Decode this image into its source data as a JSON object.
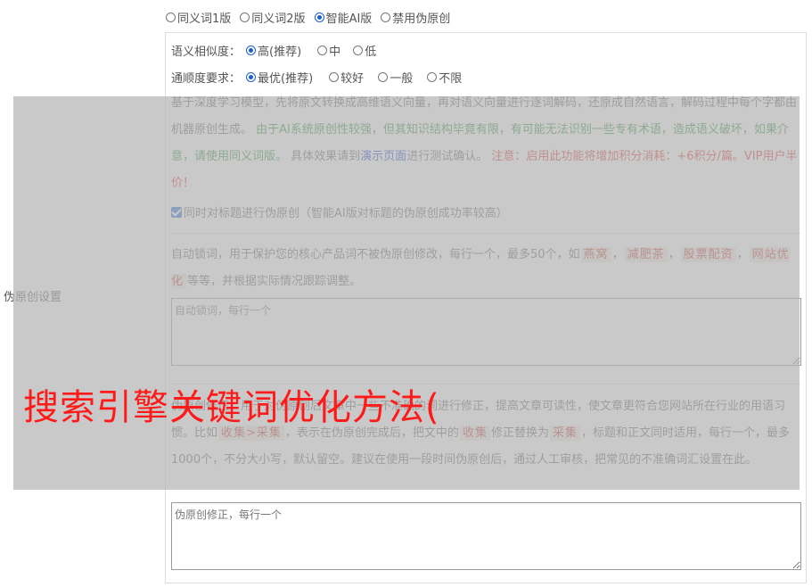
{
  "mode_options": [
    {
      "label": "同义词1版",
      "checked": false
    },
    {
      "label": "同义词2版",
      "checked": false
    },
    {
      "label": "智能AI版",
      "checked": true
    },
    {
      "label": "禁用伪原创",
      "checked": false
    }
  ],
  "section_label": "伪原创设置",
  "similarity": {
    "label": "语义相似度：",
    "options": [
      {
        "label": "高(推荐)",
        "checked": true
      },
      {
        "label": "中",
        "checked": false
      },
      {
        "label": "低",
        "checked": false
      }
    ]
  },
  "fluency": {
    "label": "通顺度要求：",
    "options": [
      {
        "label": "最优(推荐)",
        "checked": true
      },
      {
        "label": "较好",
        "checked": false
      },
      {
        "label": "一般",
        "checked": false
      },
      {
        "label": "不限",
        "checked": false
      }
    ]
  },
  "description": {
    "p1": "基于深度学习模型，先将原文转换成高维语义向量，再对语义向量进行逐词解码，还原成自然语言，解码过程中每个字都由机器原创生成。",
    "p2_green": "由于AI系统原创性较强，但其知识结构毕竟有限，有可能无法识别一些专有术语，造成语义破坏，如果介意，请使用同义词版。",
    "p3_prefix": "具体效果请到",
    "p3_link": "演示页面",
    "p3_suffix": "进行测试确认。",
    "p4_red": "注意：启用此功能将增加积分消耗：+6积分/篇。VIP用户半价！"
  },
  "title_option": {
    "label": "同时对标题进行伪原创（智能AI版对标题的伪原创成功率较高）",
    "checked": true
  },
  "lock_words": {
    "desc_prefix": "自动锁词，用于保护您的核心产品词不被伪原创修改，每行一个，最多50个，如",
    "examples": [
      "燕窝",
      "减肥茶",
      "股票配资",
      "网站优化"
    ],
    "sep": "，",
    "desc_suffix": "等等，并根据实际情况跟踪调整。",
    "placeholder": "自动锁词，每行一个"
  },
  "correction": {
    "desc_a": "伪原创修正，用于对伪原创后文章中一些不准确的词进行修正，提高文章可读性，使文章更符合您网站所在行业的用语习惯。比如",
    "example1": "收集>采集",
    "desc_b": "，表示在伪原创完成后，把文中的",
    "example2": "收集",
    "desc_c": "修正替换为",
    "example3": "采集",
    "desc_d": "，标题和正文同时适用，每行一个，最多1000个，不分大小写，默认留空。建议在使用一段时间伪原创后，通过人工审核，把常见的不准确词汇设置在此。",
    "placeholder": "伪原创修正，每行一个"
  },
  "overlay_text": "搜索引擎关键词优化方法("
}
